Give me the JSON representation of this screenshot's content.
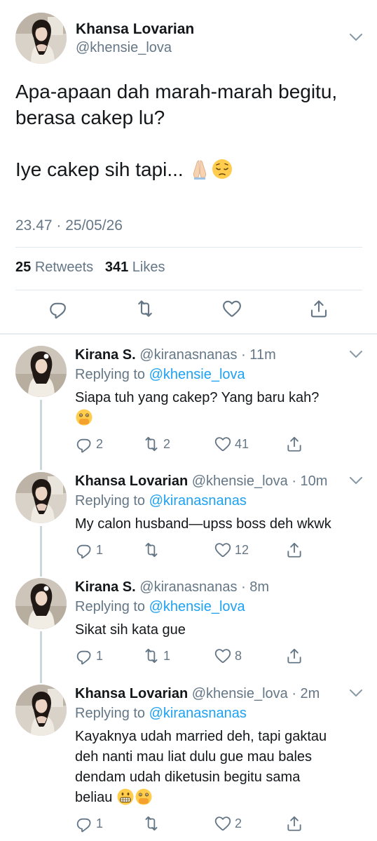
{
  "main_tweet": {
    "name": "Khansa Lovarian",
    "handle": "@khensie_lova",
    "text_line1": "Apa-apaan dah marah-marah begitu,",
    "text_line2": "berasa cakep lu?",
    "text_line3": "Iye cakep sih tapi...",
    "emojis": [
      "folded-hands-emoji",
      "pensive-face-emoji"
    ],
    "timestamp": "23.47 · 25/05/26",
    "retweets_count": "25",
    "retweets_label": "Retweets",
    "likes_count": "341",
    "likes_label": "Likes",
    "actions": [
      "reply-icon",
      "retweet-icon",
      "like-icon",
      "share-icon"
    ]
  },
  "replies": [
    {
      "name": "Kirana S.",
      "meta": "@kiranasnanas · 11m",
      "replying_prefix": "Replying to",
      "replying_to": "@khensie_lova",
      "text": "Siapa tuh yang cakep? Yang baru kah?",
      "emojis": [
        "face-with-open-eyes-and-hand-over-mouth-emoji"
      ],
      "reply_count": "2",
      "retweet_count": "2",
      "like_count": "41"
    },
    {
      "name": "Khansa Lovarian",
      "meta": "@khensie_lova · 10m",
      "replying_prefix": "Replying to",
      "replying_to": "@kiranasnanas",
      "text": "My calon husband—upss boss deh wkwk",
      "emojis": [],
      "reply_count": "1",
      "retweet_count": "",
      "like_count": "12"
    },
    {
      "name": "Kirana S.",
      "meta": "@kiranasnanas · 8m",
      "replying_prefix": "Replying to",
      "replying_to": "@khensie_lova",
      "text": "Sikat sih kata gue",
      "emojis": [],
      "reply_count": "1",
      "retweet_count": "1",
      "like_count": "8"
    },
    {
      "name": "Khansa Lovarian",
      "meta": "@khensie_lova · 2m",
      "replying_prefix": "Replying to",
      "replying_to": "@kiranasnanas",
      "text_line1": "Kayaknya udah married deh, tapi gaktau",
      "text_line2": "deh nanti mau liat dulu gue mau bales",
      "text_line3": "dendam udah diketusin begitu sama",
      "text_line4": "beliau",
      "emojis": [
        "grimacing-face-emoji",
        "face-with-open-eyes-and-hand-over-mouth-emoji"
      ],
      "reply_count": "1",
      "retweet_count": "",
      "like_count": "2"
    }
  ],
  "colors": {
    "text": "#14171a",
    "secondary": "#657786",
    "link": "#1da1f2",
    "divider": "#e1e8ed",
    "thread_line": "#ccd6dd"
  }
}
